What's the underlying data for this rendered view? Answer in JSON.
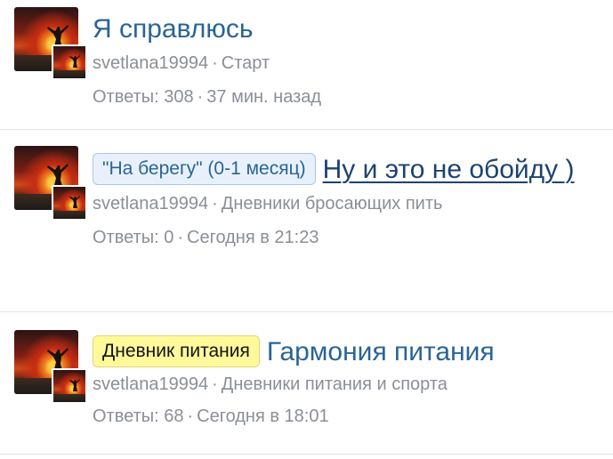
{
  "threads": [
    {
      "title": "Я справлюсь",
      "author": "svetlana19994",
      "forum": "Старт",
      "replies": "Ответы: 308",
      "time": "37 мин. назад"
    },
    {
      "prefix": "\"На берегу\" (0-1 месяц)",
      "prefix_color": "#e8f1fb",
      "title": "Ну и это не обойду )",
      "author": "svetlana19994",
      "forum": "Дневники бросающих пить",
      "replies": "Ответы: 0",
      "time": "Сегодня в 21:23"
    },
    {
      "prefix": "Дневник питания",
      "prefix_color": "#fff99c",
      "title": "Гармония питания",
      "author": "svetlana19994",
      "forum": "Дневники питания и спорта",
      "replies": "Ответы: 68",
      "time": "Сегодня в 18:01"
    }
  ],
  "separator": "·",
  "colors": {
    "link": "#2a6496",
    "meta": "#8a8f96"
  }
}
